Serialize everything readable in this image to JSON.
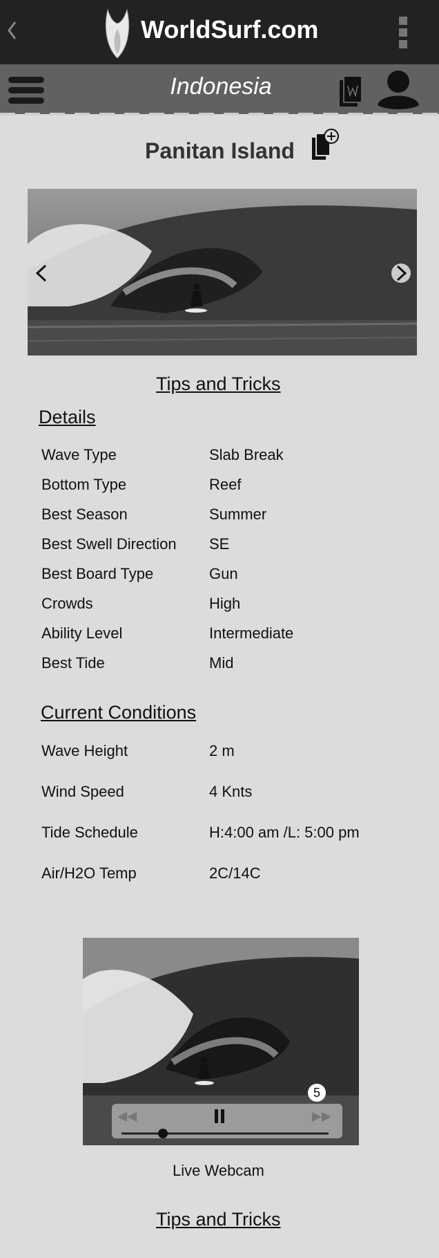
{
  "topbar": {
    "brand": "WorldSurf.com",
    "icons": {
      "back": "chevron-left-icon",
      "logo": "surfboard-logo",
      "menu": "more-vert-icon"
    }
  },
  "subbar": {
    "region": "Indonesia",
    "icons": {
      "menu": "hamburger-icon",
      "bookmark": "bookmark-icon",
      "user": "user-icon"
    }
  },
  "spot": {
    "name": "Panitan Island",
    "bookmark_add_icon": "bookmark-plus-icon"
  },
  "tips_link_top": "Tips and Tricks",
  "details": {
    "heading": "Details",
    "rows": [
      {
        "label": "Wave Type",
        "value": "Slab Break"
      },
      {
        "label": "Bottom Type",
        "value": "Reef"
      },
      {
        "label": "Best Season",
        "value": "Summer"
      },
      {
        "label": "Best Swell Direction",
        "value": "SE"
      },
      {
        "label": "Best Board Type",
        "value": "Gun"
      },
      {
        "label": "Crowds",
        "value": "High"
      },
      {
        "label": "Ability Level",
        "value": "Intermediate"
      },
      {
        "label": "Best Tide",
        "value": "Mid"
      }
    ]
  },
  "conditions": {
    "heading": "Current Conditions",
    "rows": [
      {
        "label": "Wave Height",
        "value": "2 m"
      },
      {
        "label": "Wind Speed",
        "value": "4 Knts"
      },
      {
        "label": "Tide Schedule",
        "value": "H:4:00 am /L: 5:00 pm"
      },
      {
        "label": "Air/H2O Temp",
        "value": "2C/14C"
      }
    ]
  },
  "webcam": {
    "label": "Live Webcam",
    "badge": "5",
    "progress": 0.2
  },
  "tips_link_bottom": "Tips and Tricks",
  "colors": {
    "topbar": "#222222",
    "subbar": "#616161",
    "page": "#dcdcdc"
  }
}
